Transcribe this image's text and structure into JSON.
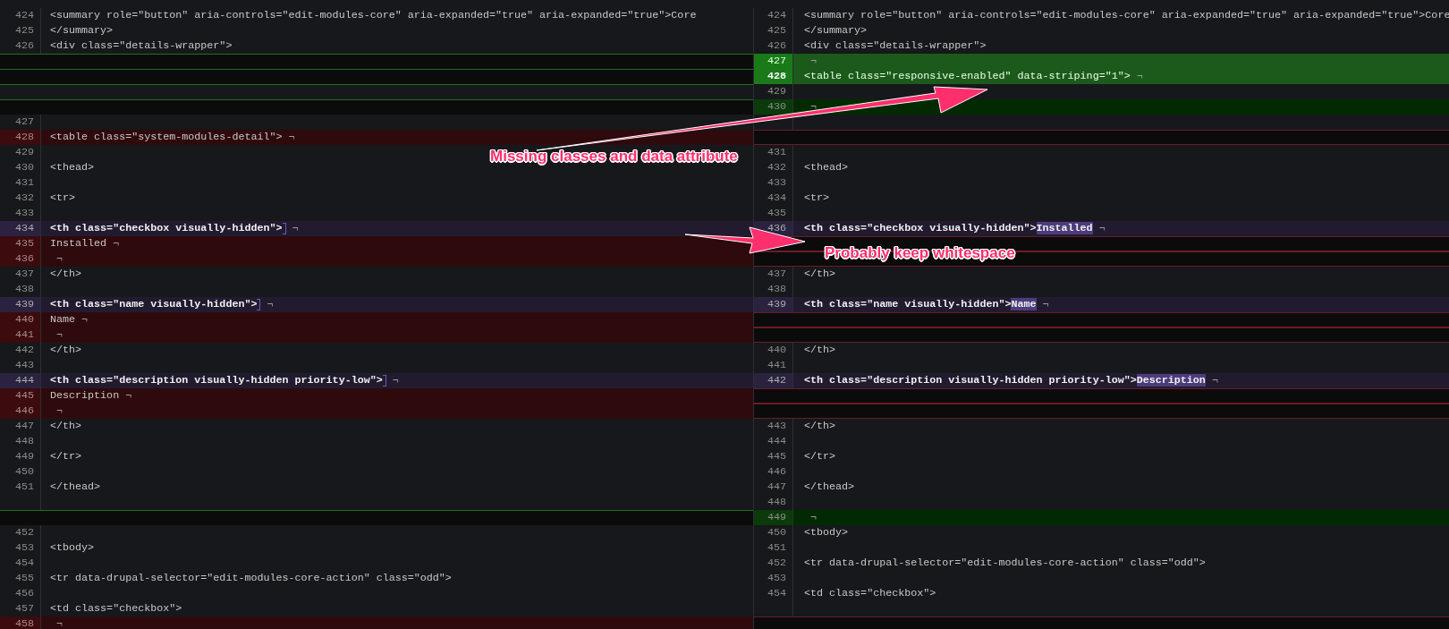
{
  "rows": [
    {
      "left": {
        "kind": "context",
        "number": "424",
        "text": "<summary role=\"button\" aria-controls=\"edit-modules-core\" aria-expanded=\"true\" aria-expanded=\"true\">Core"
      },
      "right": {
        "kind": "context",
        "number": "424",
        "text": "<summary role=\"button\" aria-controls=\"edit-modules-core\" aria-expanded=\"true\" aria-expanded=\"true\">Core"
      }
    },
    {
      "left": {
        "kind": "context",
        "number": "425",
        "text": "</summary>"
      },
      "right": {
        "kind": "context",
        "number": "425",
        "text": "</summary>"
      }
    },
    {
      "left": {
        "kind": "context",
        "number": "426",
        "text": "<div class=\"details-wrapper\">"
      },
      "right": {
        "kind": "context",
        "number": "426",
        "text": "<div class=\"details-wrapper\">"
      }
    },
    {
      "left": {
        "kind": "filler"
      },
      "right": {
        "kind": "added",
        "number": "427",
        "eol": "¬"
      }
    },
    {
      "left": {
        "kind": "filler"
      },
      "right": {
        "kind": "added",
        "number": "428",
        "current": true,
        "text": "<table class=\"responsive-enabled\" data-striping=\"1\">",
        "eol": "¬"
      }
    },
    {
      "left": {
        "kind": "filler_gray"
      },
      "right": {
        "kind": "context",
        "number": "429"
      }
    },
    {
      "left": {
        "kind": "filler"
      },
      "right": {
        "kind": "added_faint",
        "number": "430",
        "eol": "¬"
      }
    },
    {
      "left": {
        "kind": "context",
        "number": "427"
      },
      "right": {
        "kind": "context"
      }
    },
    {
      "left": {
        "kind": "removed",
        "number": "428",
        "text": "<table class=\"system-modules-detail\">",
        "eol": "¬"
      },
      "right": {
        "kind": "filler"
      }
    },
    {
      "left": {
        "kind": "context",
        "number": "429"
      },
      "right": {
        "kind": "context",
        "number": "431"
      }
    },
    {
      "left": {
        "kind": "context",
        "number": "430",
        "text": "<thead>"
      },
      "right": {
        "kind": "context",
        "number": "432",
        "text": "<thead>"
      }
    },
    {
      "left": {
        "kind": "context",
        "number": "431"
      },
      "right": {
        "kind": "context",
        "number": "433"
      }
    },
    {
      "left": {
        "kind": "context",
        "number": "432",
        "text": "<tr>"
      },
      "right": {
        "kind": "context",
        "number": "434",
        "text": "<tr>"
      }
    },
    {
      "left": {
        "kind": "context",
        "number": "433"
      },
      "right": {
        "kind": "context",
        "number": "435"
      }
    },
    {
      "left": {
        "kind": "modified",
        "number": "434",
        "text": "<th class=\"checkbox visually-hidden\">",
        "cursor": true,
        "eol": "¬"
      },
      "right": {
        "kind": "modified",
        "number": "436",
        "text": "<th class=\"checkbox visually-hidden\">",
        "changed": "Installed",
        "eol": "¬"
      }
    },
    {
      "left": {
        "kind": "removed",
        "number": "435",
        "text": "Installed",
        "eol": "¬"
      },
      "right": {
        "kind": "filler"
      }
    },
    {
      "left": {
        "kind": "removed",
        "number": "436",
        "eol": "¬"
      },
      "right": {
        "kind": "filler"
      }
    },
    {
      "left": {
        "kind": "context",
        "number": "437",
        "text": "</th>"
      },
      "right": {
        "kind": "context",
        "number": "437",
        "text": "</th>"
      }
    },
    {
      "left": {
        "kind": "context",
        "number": "438"
      },
      "right": {
        "kind": "context",
        "number": "438"
      }
    },
    {
      "left": {
        "kind": "modified",
        "number": "439",
        "text": "<th class=\"name visually-hidden\">",
        "cursor": true,
        "eol": "¬"
      },
      "right": {
        "kind": "modified",
        "number": "439",
        "text": "<th class=\"name visually-hidden\">",
        "changed": "Name",
        "eol": "¬"
      }
    },
    {
      "left": {
        "kind": "removed",
        "number": "440",
        "text": "Name",
        "eol": "¬"
      },
      "right": {
        "kind": "filler"
      }
    },
    {
      "left": {
        "kind": "removed",
        "number": "441",
        "eol": "¬"
      },
      "right": {
        "kind": "filler"
      }
    },
    {
      "left": {
        "kind": "context",
        "number": "442",
        "text": "</th>"
      },
      "right": {
        "kind": "context",
        "number": "440",
        "text": "</th>"
      }
    },
    {
      "left": {
        "kind": "context",
        "number": "443"
      },
      "right": {
        "kind": "context",
        "number": "441"
      }
    },
    {
      "left": {
        "kind": "modified",
        "number": "444",
        "text": "<th class=\"description visually-hidden priority-low\">",
        "cursor": true,
        "eol": "¬"
      },
      "right": {
        "kind": "modified",
        "number": "442",
        "text": "<th class=\"description visually-hidden priority-low\">",
        "changed": "Description",
        "eol": "¬"
      }
    },
    {
      "left": {
        "kind": "removed",
        "number": "445",
        "text": "Description",
        "eol": "¬"
      },
      "right": {
        "kind": "filler"
      }
    },
    {
      "left": {
        "kind": "removed",
        "number": "446",
        "eol": "¬"
      },
      "right": {
        "kind": "filler"
      }
    },
    {
      "left": {
        "kind": "context",
        "number": "447",
        "text": "</th>"
      },
      "right": {
        "kind": "context",
        "number": "443",
        "text": "</th>"
      }
    },
    {
      "left": {
        "kind": "context",
        "number": "448"
      },
      "right": {
        "kind": "context",
        "number": "444"
      }
    },
    {
      "left": {
        "kind": "context",
        "number": "449",
        "text": "</tr>"
      },
      "right": {
        "kind": "context",
        "number": "445",
        "text": "</tr>"
      }
    },
    {
      "left": {
        "kind": "context",
        "number": "450"
      },
      "right": {
        "kind": "context",
        "number": "446"
      }
    },
    {
      "left": {
        "kind": "context",
        "number": "451",
        "text": "</thead>"
      },
      "right": {
        "kind": "context",
        "number": "447",
        "text": "</thead>"
      }
    },
    {
      "left": {
        "kind": "context"
      },
      "right": {
        "kind": "context",
        "number": "448"
      }
    },
    {
      "left": {
        "kind": "filler"
      },
      "right": {
        "kind": "added_faint",
        "number": "449",
        "eol": "¬"
      }
    },
    {
      "left": {
        "kind": "context",
        "number": "452"
      },
      "right": {
        "kind": "context",
        "number": "450",
        "text": "<tbody>"
      }
    },
    {
      "left": {
        "kind": "context",
        "number": "453",
        "text": "<tbody>"
      },
      "right": {
        "kind": "context",
        "number": "451"
      }
    },
    {
      "left": {
        "kind": "context",
        "number": "454"
      },
      "right": {
        "kind": "context",
        "number": "452",
        "text": "<tr data-drupal-selector=\"edit-modules-core-action\" class=\"odd\">"
      }
    },
    {
      "left": {
        "kind": "context",
        "number": "455",
        "text": "<tr data-drupal-selector=\"edit-modules-core-action\" class=\"odd\">"
      },
      "right": {
        "kind": "context",
        "number": "453"
      }
    },
    {
      "left": {
        "kind": "context",
        "number": "456"
      },
      "right": {
        "kind": "context",
        "number": "454",
        "text": "<td class=\"checkbox\">"
      }
    },
    {
      "left": {
        "kind": "context",
        "number": "457",
        "text": "<td class=\"checkbox\">"
      },
      "right": {
        "kind": "context"
      }
    },
    {
      "left": {
        "kind": "removed",
        "number": "458",
        "eol": "¬"
      },
      "right": {
        "kind": "filler"
      }
    }
  ],
  "annotations": [
    {
      "text": "Missing classes and data attribute"
    },
    {
      "text": "Probably keep whitespace"
    }
  ]
}
